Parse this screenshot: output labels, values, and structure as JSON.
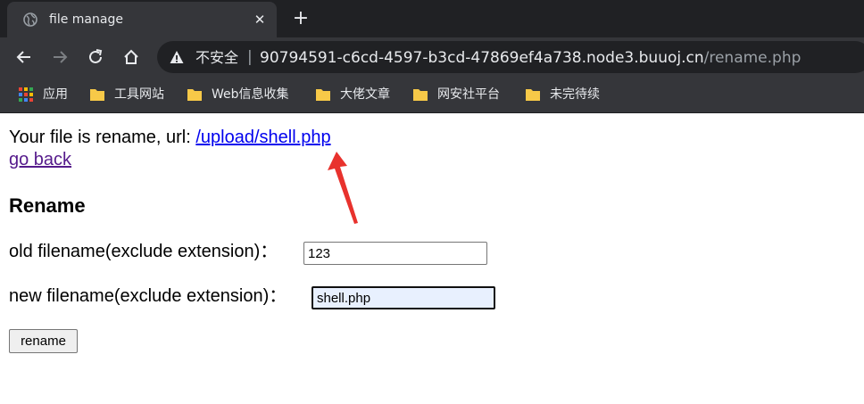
{
  "browser": {
    "tab": {
      "title": "file manage",
      "close": "✕"
    },
    "new_tab": "+",
    "omnibox": {
      "security_label": "不安全",
      "separator": "|",
      "host": "90794591-c6cd-4597-b3cd-47869ef4a738.node3.buuoj.cn",
      "path": "/rename.php"
    },
    "bookmarks": [
      {
        "label": "应用",
        "icon": "apps-grid-icon"
      },
      {
        "label": "工具网站",
        "icon": "folder-icon"
      },
      {
        "label": "Web信息收集",
        "icon": "folder-icon"
      },
      {
        "label": "大佬文章",
        "icon": "folder-icon"
      },
      {
        "label": "网安社平台",
        "icon": "folder-icon"
      },
      {
        "label": "未完待续",
        "icon": "folder-icon"
      }
    ]
  },
  "page": {
    "message_prefix": "Your file is rename, url: ",
    "file_url": "/upload/shell.php",
    "go_back": "go back",
    "heading": "Rename",
    "old_label": "old filename(exclude extension)：",
    "old_value": "123",
    "new_label": "new filename(exclude extension)：",
    "new_value": "shell.php",
    "submit": "rename"
  },
  "colors": {
    "chrome_dark": "#202124",
    "chrome_toolbar": "#35363a",
    "link": "#0000ee",
    "visited_link": "#551a8b",
    "annotation_arrow": "#e8322d",
    "folder": "#f7c948"
  }
}
